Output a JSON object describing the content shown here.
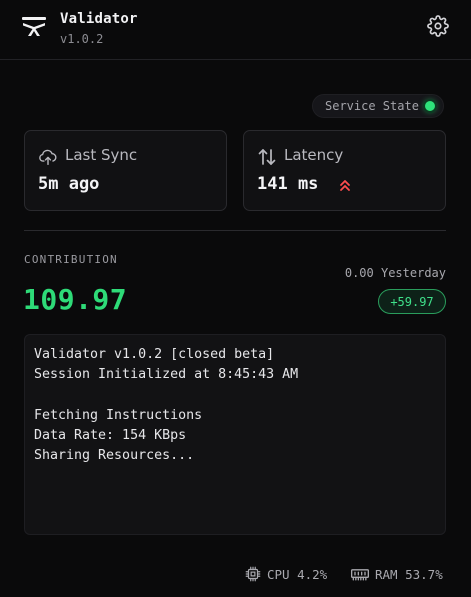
{
  "header": {
    "title": "Validator",
    "version": "v1.0.2",
    "logo_icon": "validator-logo-icon",
    "settings_icon": "gear-icon"
  },
  "service": {
    "label": "Service State",
    "status_color": "#2ee27a"
  },
  "stats": {
    "sync": {
      "icon": "cloud-upload-icon",
      "label": "Last Sync",
      "value": "5m ago"
    },
    "latency": {
      "icon": "arrows-up-down-icon",
      "label": "Latency",
      "value": "141 ms",
      "trend_icon": "double-chevron-up-icon",
      "trend_color": "#ff4d4f"
    }
  },
  "contribution": {
    "label": "CONTRIBUTION",
    "value": "109.97",
    "yesterday": "0.00 Yesterday",
    "delta": "+59.97",
    "accent": "#2edb78"
  },
  "console": {
    "lines": [
      "Validator v1.0.2 [closed beta]",
      "Session Initialized at 8:45:43 AM",
      "",
      "Fetching Instructions",
      "Data Rate: 154 KBps",
      "Sharing Resources..."
    ]
  },
  "footer": {
    "cpu": {
      "icon": "cpu-chip-icon",
      "text": "CPU 4.2%"
    },
    "ram": {
      "icon": "memory-icon",
      "text": "RAM 53.7%"
    }
  }
}
